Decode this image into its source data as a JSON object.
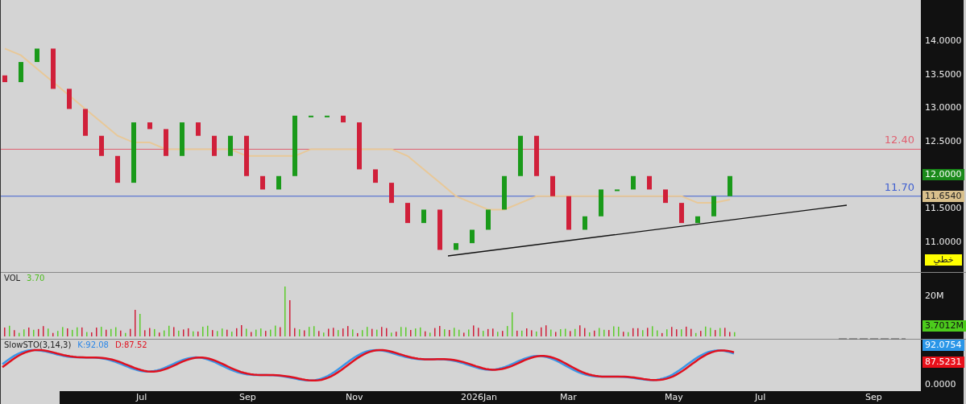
{
  "price_pane": {
    "axis_labels": [
      "14.0000",
      "13.5000",
      "13.0000",
      "12.5000",
      "11.5000",
      "11.0000"
    ],
    "levels": [
      {
        "label": "12.40",
        "color": "#e06070"
      },
      {
        "label": "11.70",
        "color": "#3f5fd0"
      }
    ],
    "price_tags": [
      {
        "text": "12.0000",
        "kind": "last"
      },
      {
        "text": "11.6540",
        "kind": "average"
      },
      {
        "text": "خطي",
        "kind": "mode"
      }
    ]
  },
  "time_axis": [
    "Jul",
    "Sep",
    "Nov",
    "2026Jan",
    "Mar",
    "May",
    "Jul",
    "Sep"
  ],
  "volume_pane": {
    "label": "VOL",
    "value": "3.70",
    "axis_label": "20M",
    "tag": "3.7012M"
  },
  "stochastic_pane": {
    "label": "SlowSTO(3,14,3)",
    "k": "K:92.08",
    "d": "D:87.52",
    "k_tag": "92.0754",
    "d_tag": "87.5231",
    "axis_label": "0.0000"
  }
}
